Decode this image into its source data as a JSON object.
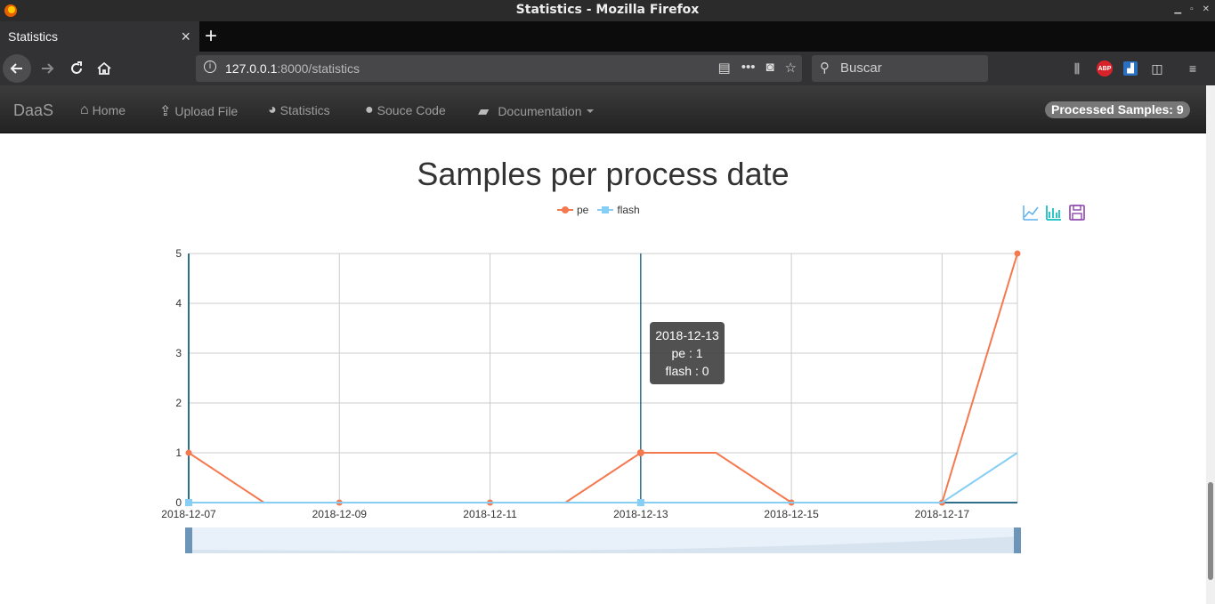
{
  "window": {
    "title": "Statistics - Mozilla Firefox"
  },
  "tab": {
    "label": "Statistics",
    "close": "×",
    "new_tab": "+"
  },
  "navbar": {
    "url_host": "127.0.0.1",
    "url_rest": ":8000/statistics",
    "search_placeholder": "Buscar"
  },
  "toolbar_icons": {
    "abp_label": "ABP"
  },
  "site": {
    "brand": "DaaS",
    "nav": [
      {
        "label": "Home",
        "icon": "home-icon"
      },
      {
        "label": "Upload File",
        "icon": "upload-icon"
      },
      {
        "label": "Statistics",
        "icon": "pie-chart-icon"
      },
      {
        "label": "Souce Code",
        "icon": "github-icon"
      },
      {
        "label": "Documentation",
        "icon": "book-icon"
      }
    ],
    "badge": "Processed Samples: 9"
  },
  "tooltip": {
    "date": "2018-12-13",
    "pe": "pe : 1",
    "flash": "flash : 0"
  },
  "colors": {
    "pe": "#f5794f",
    "flash": "#87cef4",
    "axis": "#2f6f8c"
  },
  "chart_data": {
    "type": "line",
    "title": "Samples per process date",
    "x": [
      "2018-12-07",
      "2018-12-08",
      "2018-12-09",
      "2018-12-10",
      "2018-12-11",
      "2018-12-12",
      "2018-12-13",
      "2018-12-14",
      "2018-12-15",
      "2018-12-16",
      "2018-12-17",
      "2018-12-18"
    ],
    "x_tick_labels": [
      "2018-12-07",
      "2018-12-09",
      "2018-12-11",
      "2018-12-13",
      "2018-12-15",
      "2018-12-17"
    ],
    "series": [
      {
        "name": "pe",
        "values": [
          1,
          0,
          0,
          0,
          0,
          0,
          1,
          1,
          0,
          0,
          0,
          5
        ]
      },
      {
        "name": "flash",
        "values": [
          0,
          0,
          0,
          0,
          0,
          0,
          0,
          0,
          0,
          0,
          0,
          1
        ]
      }
    ],
    "ylim": [
      0,
      5
    ],
    "y_ticks": [
      "0",
      "1",
      "2",
      "3",
      "4",
      "5"
    ],
    "grid": true,
    "legend_position": "top-center",
    "highlighted_x": "2018-12-13"
  }
}
